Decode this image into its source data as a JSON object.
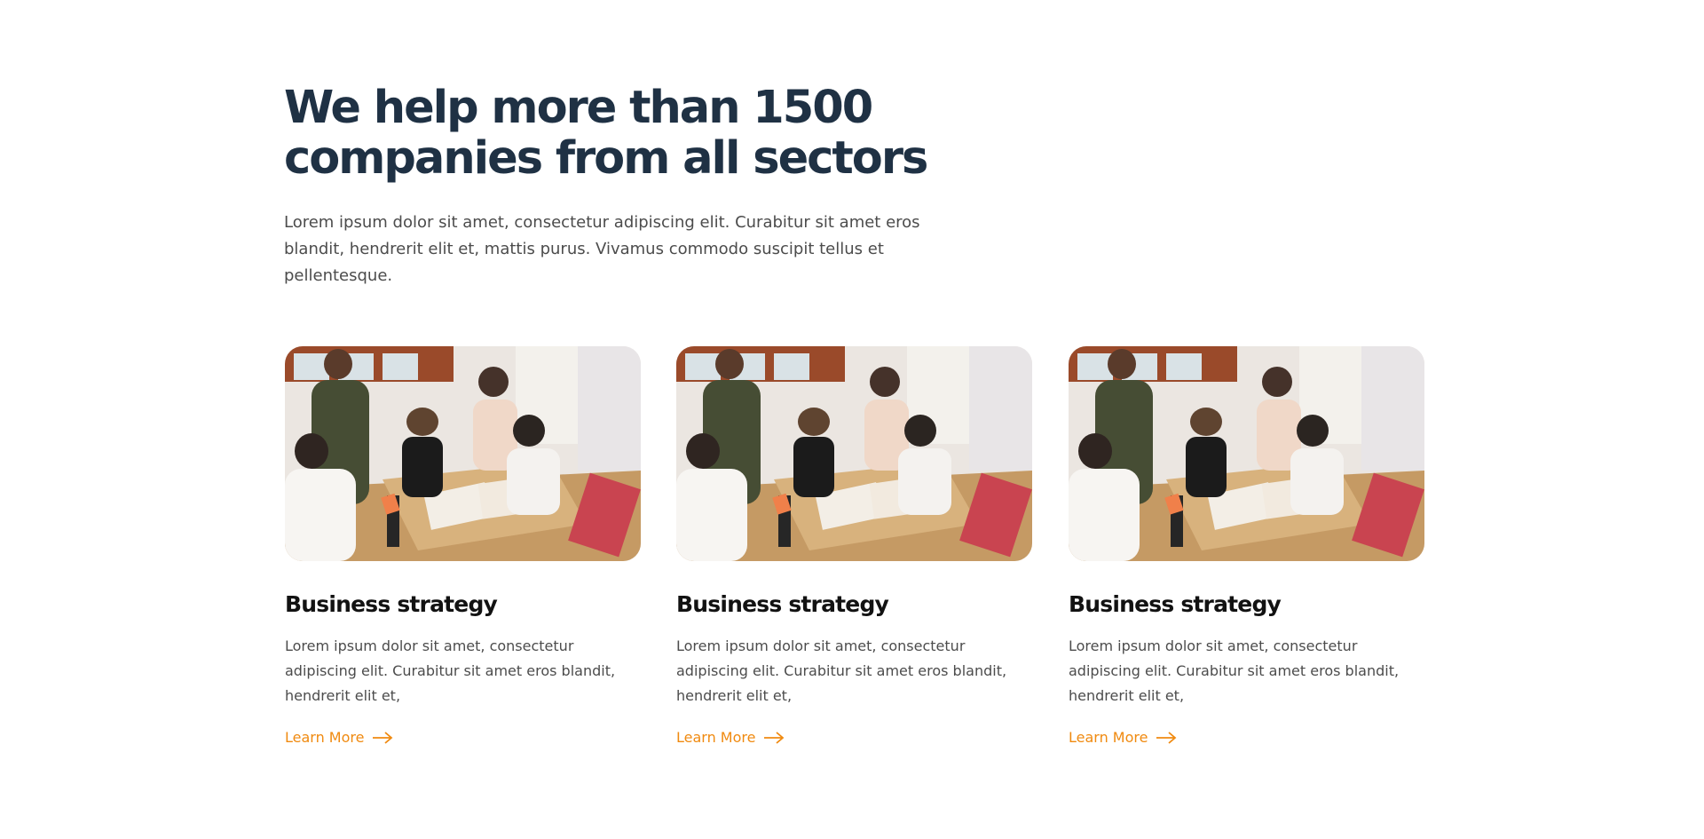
{
  "section": {
    "heading": "We help more than 1500 companies from all sectors",
    "intro": "Lorem ipsum dolor sit amet, consectetur adipiscing elit. Curabitur sit amet eros blandit, hendrerit elit et, mattis purus. Vivamus commodo suscipit tellus et pellentesque."
  },
  "cards": [
    {
      "title": "Business strategy",
      "text": "Lorem ipsum dolor sit amet, consectetur adipiscing elit. Curabitur sit amet eros blandit, hendrerit elit et,",
      "link": "Learn More",
      "icon": "arrow-right-icon",
      "image": "team-meeting-photo"
    },
    {
      "title": "Business strategy",
      "text": "Lorem ipsum dolor sit amet, consectetur adipiscing elit. Curabitur sit amet eros blandit, hendrerit elit et,",
      "link": "Learn More",
      "icon": "arrow-right-icon",
      "image": "team-meeting-photo"
    },
    {
      "title": "Business strategy",
      "text": "Lorem ipsum dolor sit amet, consectetur adipiscing elit. Curabitur sit amet eros blandit, hendrerit elit et,",
      "link": "Learn More",
      "icon": "arrow-right-icon",
      "image": "team-meeting-photo"
    }
  ],
  "colors": {
    "heading": "#1f3144",
    "body_text": "#4c4c4c",
    "card_title": "#121212",
    "accent": "#f08a10",
    "background": "#ffffff"
  }
}
